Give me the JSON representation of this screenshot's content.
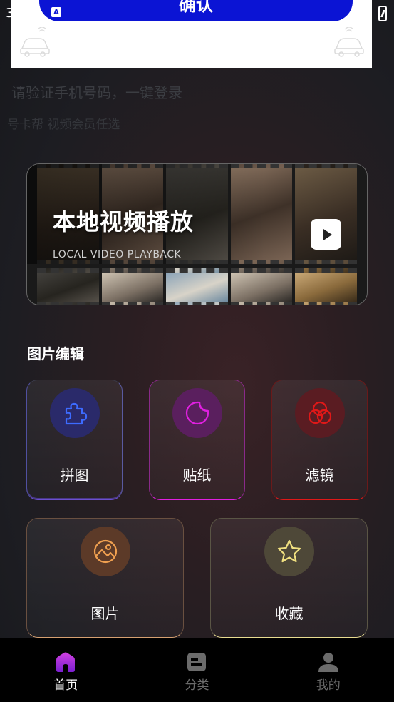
{
  "status": {
    "time": "3"
  },
  "login_overlay": {
    "confirm_label": "确认",
    "phone_prompt": "请验证手机号码，一键登录",
    "promo_text": "号卡帮 视频会员任选"
  },
  "banner": {
    "title": "本地视频播放",
    "subtitle": "LOCAL VIDEO PLAYBACK"
  },
  "section": {
    "title": "图片编辑"
  },
  "tiles": [
    {
      "label": "拼图",
      "icon": "puzzle-icon",
      "accent": "#3d6bff"
    },
    {
      "label": "贴纸",
      "icon": "sticker-icon",
      "accent": "#e020e0"
    },
    {
      "label": "滤镜",
      "icon": "filter-icon",
      "accent": "#e01818"
    },
    {
      "label": "图片",
      "icon": "image-icon",
      "accent": "#f0a050"
    },
    {
      "label": "收藏",
      "icon": "star-icon",
      "accent": "#f0e080"
    }
  ],
  "tabbar": {
    "items": [
      {
        "label": "首页",
        "icon": "home-icon",
        "active": true
      },
      {
        "label": "分类",
        "icon": "category-icon",
        "active": false
      },
      {
        "label": "我的",
        "icon": "profile-icon",
        "active": false
      }
    ]
  }
}
